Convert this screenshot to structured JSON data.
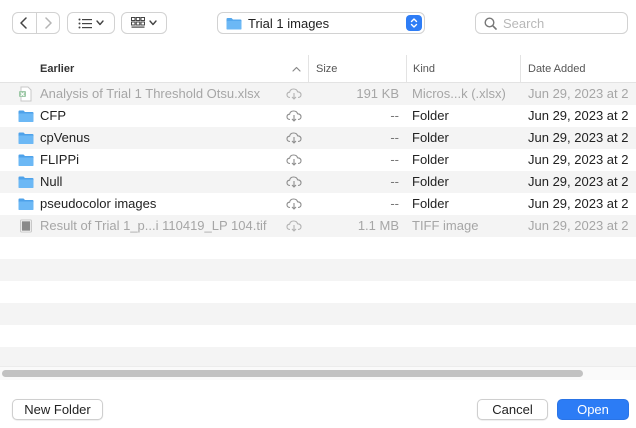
{
  "toolbar": {
    "location_title": "Trial 1 images",
    "search_placeholder": "Search"
  },
  "columns": {
    "name": "Earlier",
    "size": "Size",
    "kind": "Kind",
    "date": "Date Added"
  },
  "files": [
    {
      "name": "Analysis of Trial 1 Threshold Otsu.xlsx",
      "size": "191 KB",
      "kind": "Micros...k (.xlsx)",
      "date": "Jun 29, 2023 at 2",
      "icon": "excel-file-icon",
      "dimmed": true
    },
    {
      "name": "CFP",
      "size": "--",
      "kind": "Folder",
      "date": "Jun 29, 2023 at 2",
      "icon": "folder-icon",
      "dimmed": false
    },
    {
      "name": "cpVenus",
      "size": "--",
      "kind": "Folder",
      "date": "Jun 29, 2023 at 2",
      "icon": "folder-icon",
      "dimmed": false
    },
    {
      "name": "FLIPPi",
      "size": "--",
      "kind": "Folder",
      "date": "Jun 29, 2023 at 2",
      "icon": "folder-icon",
      "dimmed": false
    },
    {
      "name": "Null",
      "size": "--",
      "kind": "Folder",
      "date": "Jun 29, 2023 at 2",
      "icon": "folder-icon",
      "dimmed": false
    },
    {
      "name": "pseudocolor images",
      "size": "--",
      "kind": "Folder",
      "date": "Jun 29, 2023 at 2",
      "icon": "folder-icon",
      "dimmed": false
    },
    {
      "name": "Result of Trial 1_p...i 110419_LP 104.tif",
      "size": "1.1 MB",
      "kind": "TIFF image",
      "date": "Jun 29, 2023 at 2",
      "icon": "tiff-file-icon",
      "dimmed": true
    }
  ],
  "buttons": {
    "new_folder": "New Folder",
    "cancel": "Cancel",
    "open": "Open"
  },
  "colors": {
    "accent": "#2c7cf5",
    "folder": "#55a8ee",
    "row_alt": "#f4f4f4"
  }
}
